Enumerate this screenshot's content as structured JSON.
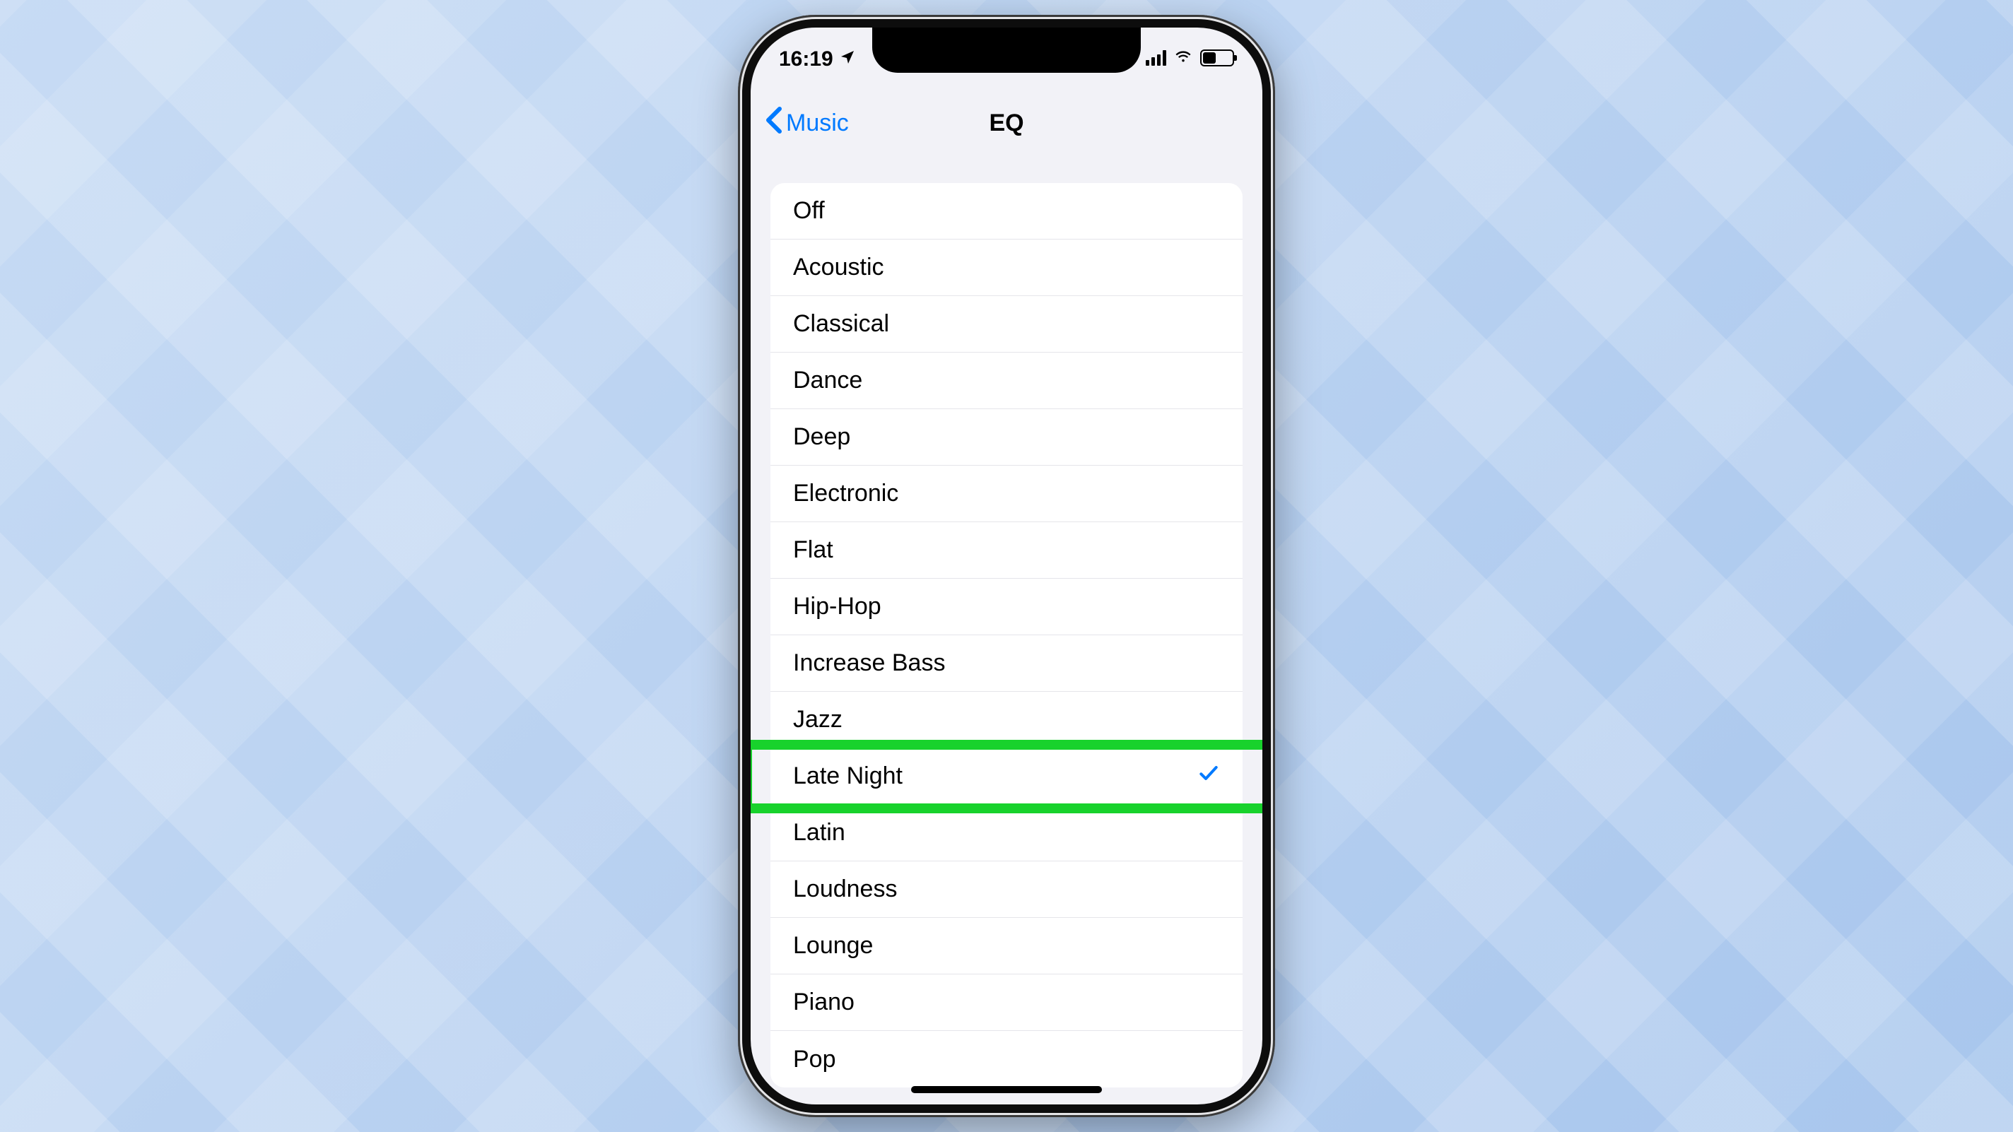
{
  "status": {
    "time": "16:19"
  },
  "nav": {
    "back_label": "Music",
    "title": "EQ"
  },
  "eq": {
    "selected_index": 10,
    "options": [
      "Off",
      "Acoustic",
      "Classical",
      "Dance",
      "Deep",
      "Electronic",
      "Flat",
      "Hip-Hop",
      "Increase Bass",
      "Jazz",
      "Late Night",
      "Latin",
      "Loudness",
      "Lounge",
      "Piano",
      "Pop"
    ]
  },
  "annotation": {
    "highlighted_index": 10
  },
  "colors": {
    "tint": "#007aff",
    "highlight": "#18d22c",
    "bg": "#f2f2f7"
  }
}
